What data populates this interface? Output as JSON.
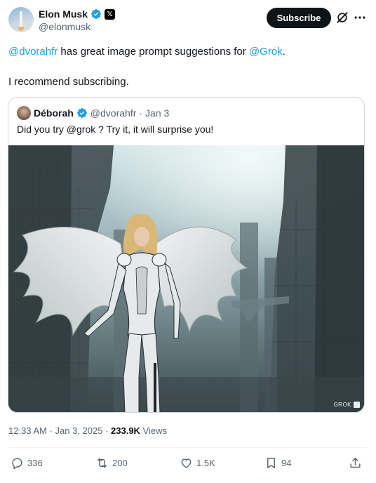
{
  "author": {
    "display_name": "Elon Musk",
    "handle": "@elonmusk",
    "verified_icon": "verified-badge-icon",
    "affiliate_badge": "𝕏"
  },
  "header": {
    "subscribe_label": "Subscribe",
    "grok_icon": "grok-icon",
    "more_icon": "more-icon"
  },
  "post": {
    "line1_mention": "@dvorahfr",
    "line1_middle": " has great image prompt suggestions for ",
    "line1_mention2": "@Grok",
    "line1_end": ".",
    "line2": "I recommend subscribing."
  },
  "quoted": {
    "display_name": "Déborah",
    "handle": "@dvorahfr",
    "separator": "·",
    "date": "Jan 3",
    "text": "Did you try @grok ? Try it, it will surprise you!",
    "image_watermark": "GROK"
  },
  "meta": {
    "time": "12:33 AM",
    "separator": " · ",
    "date": "Jan 3, 2025",
    "separator2": " · ",
    "views_count": "233.9K",
    "views_label": " Views"
  },
  "actions": {
    "replies": "336",
    "reposts": "200",
    "likes": "1.5K",
    "bookmarks": "94"
  },
  "colors": {
    "accent": "#1d9bf0",
    "text_primary": "#0f1419",
    "text_secondary": "#536471",
    "border": "#cfd9de",
    "button_bg": "#0f1419"
  }
}
